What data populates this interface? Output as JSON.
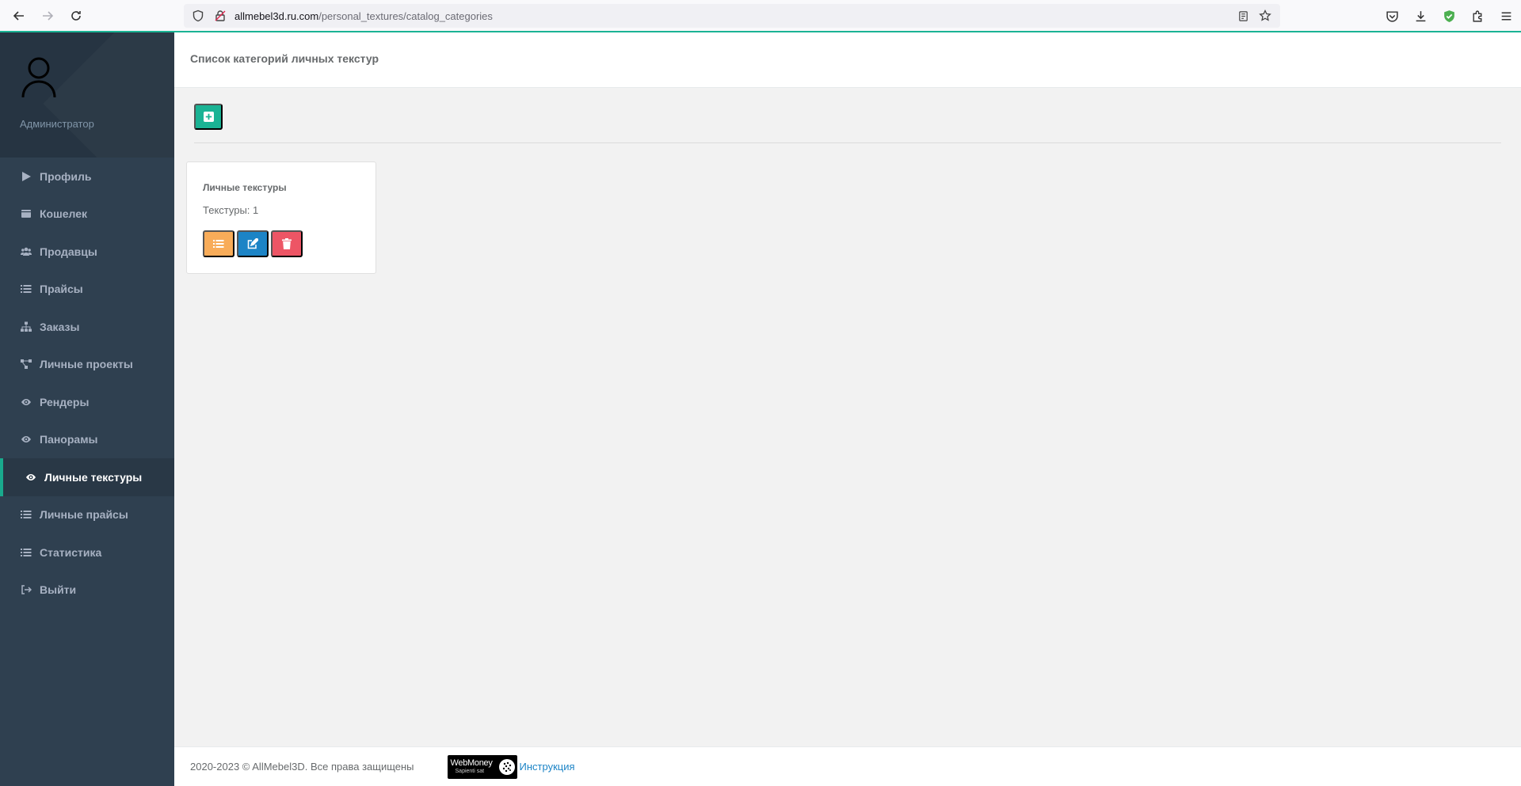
{
  "browser": {
    "url_host": "allmebel3d.ru.com",
    "url_path": "/personal_textures/catalog_categories"
  },
  "sidebar": {
    "role": "Администратор",
    "items": [
      {
        "label": "Профиль",
        "icon": "play-icon"
      },
      {
        "label": "Кошелек",
        "icon": "wallet-icon"
      },
      {
        "label": "Продавцы",
        "icon": "users-icon"
      },
      {
        "label": "Прайсы",
        "icon": "list-icon"
      },
      {
        "label": "Заказы",
        "icon": "sitemap-icon"
      },
      {
        "label": "Личные проекты",
        "icon": "share-nodes-icon"
      },
      {
        "label": "Рендеры",
        "icon": "eye-icon"
      },
      {
        "label": "Панорамы",
        "icon": "eye-icon"
      },
      {
        "label": "Личные текстуры",
        "icon": "eye-icon",
        "active": true
      },
      {
        "label": "Личные прайсы",
        "icon": "list-icon"
      },
      {
        "label": "Статистика",
        "icon": "list-icon"
      },
      {
        "label": "Выйти",
        "icon": "sign-out-icon"
      }
    ]
  },
  "header": {
    "title": "Список категорий личных текстур"
  },
  "categories": [
    {
      "title": "Личные текстуры",
      "count_text": "Текстуры: 1"
    }
  ],
  "footer": {
    "copyright": "2020-2023 © AllMebel3D. Все права защищены",
    "webmoney_name": "WebMoney",
    "webmoney_sub": "Sapienti sat",
    "instruction_link": "Инструкция"
  },
  "colors": {
    "sidebar_bg": "#2f4050",
    "accent": "#1ab394",
    "warning": "#f8ac59",
    "primary": "#1c84c6",
    "danger": "#ed5565"
  }
}
